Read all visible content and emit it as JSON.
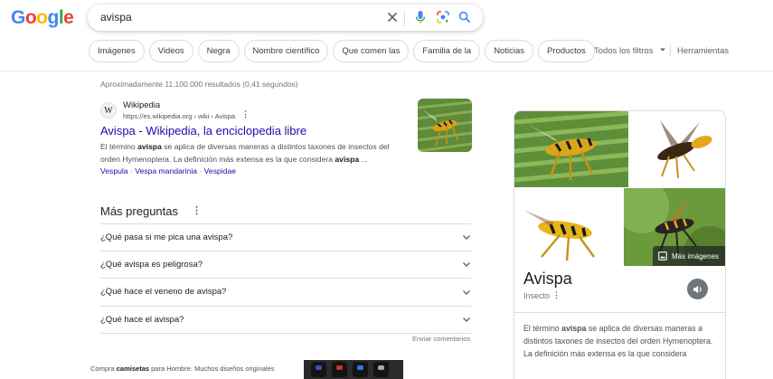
{
  "logo": {
    "letters": [
      "G",
      "o",
      "o",
      "g",
      "l",
      "e"
    ],
    "colors": [
      "#4285F4",
      "#EA4335",
      "#FBBC05",
      "#4285F4",
      "#34A853",
      "#EA4335"
    ]
  },
  "search": {
    "query": "avispa",
    "icons": [
      "close-icon",
      "microphone-icon",
      "lens-icon",
      "search-icon"
    ]
  },
  "chips": [
    "Imágenes",
    "Videos",
    "Negra",
    "Nombre científico",
    "Que comen las",
    "Familia de la",
    "Noticias",
    "Productos"
  ],
  "tools": {
    "filters": "Todos los filtros",
    "tools": "Herramientas"
  },
  "results": {
    "stats": "Aproximadamente 11.100.000 resultados (0,41 segundos)",
    "first": {
      "favicon": "W",
      "site_name": "Wikipedia",
      "url": "https://es.wikipedia.org › wiki › Avispa",
      "title": "Avispa - Wikipedia, la enciclopedia libre",
      "snippet_parts": [
        {
          "t": "El término ",
          "b": false
        },
        {
          "t": "avispa",
          "b": true
        },
        {
          "t": " se aplica de diversas maneras a distintos taxones de insectos del orden Hymenoptera. La definición más extensa es la que considera ",
          "b": false
        },
        {
          "t": "avispa",
          "b": true
        },
        {
          "t": " ...",
          "b": false
        }
      ],
      "sublinks": [
        "Vespula",
        "Vespa mandarinia",
        "Vespidae"
      ]
    }
  },
  "paa": {
    "title": "Más preguntas",
    "questions": [
      "¿Qué pasa si me pica una avispa?",
      "¿Qué avispa es peligrosa?",
      "¿Qué hace el veneno de avispa?",
      "¿Qué hace el avispa?"
    ],
    "feedback": "Enviar comentarios"
  },
  "bottom": {
    "snippet_parts": [
      {
        "t": "Compra ",
        "b": false
      },
      {
        "t": "camisetas",
        "b": true
      },
      {
        "t": " para Hombre. Muchos diseños originales",
        "b": false
      }
    ]
  },
  "knowledge_panel": {
    "title": "Avispa",
    "subtitle": "Insecto",
    "more_images": "Más imágenes",
    "description_parts": [
      {
        "t": "El término ",
        "b": false
      },
      {
        "t": "avispa",
        "b": true
      },
      {
        "t": " se aplica de diversas maneras a distintos taxones de insectos del orden Hymenoptera. La definición más extensa es la que considera",
        "b": false
      }
    ]
  }
}
